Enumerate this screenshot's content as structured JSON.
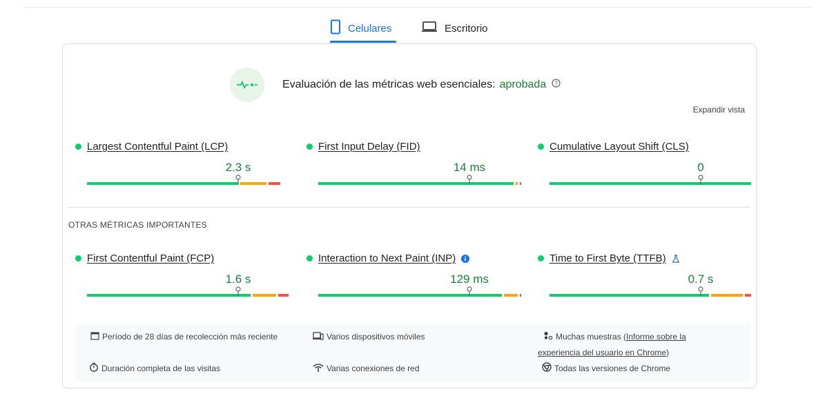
{
  "tabs": [
    {
      "label": "Celulares",
      "icon": "mobile-phone-icon",
      "active": true
    },
    {
      "label": "Escritorio",
      "icon": "laptop-icon",
      "active": false
    }
  ],
  "assessment": {
    "text": "Evaluación de las métricas web esenciales:",
    "status": "aprobada",
    "icon": "pulse-icon"
  },
  "expand_label": "Expandir vista",
  "section_title": "OTRAS MÉTRICAS IMPORTANTES",
  "colors": {
    "good": "#0cce6b",
    "needs_improvement": "#ffa400",
    "poor": "#ff4e42",
    "accent": "#1a73e8",
    "value_green": "#188038"
  },
  "core_metrics": [
    {
      "label": "Largest Contentful Paint (LCP)",
      "value": "2.3 s",
      "distribution": {
        "good": 0.75,
        "needs_improvement": 0.14,
        "poor": 0.07
      },
      "marker": 0.75
    },
    {
      "label": "First Input Delay (FID)",
      "value": "14 ms",
      "distribution": {
        "good": 0.97,
        "needs_improvement": 0.02,
        "poor": 0.01
      },
      "marker": 0.75
    },
    {
      "label": "Cumulative Layout Shift (CLS)",
      "value": "0",
      "distribution": {
        "good": 1.0,
        "needs_improvement": 0,
        "poor": 0
      },
      "marker": 0.75
    }
  ],
  "other_metrics": [
    {
      "label": "First Contentful Paint (FCP)",
      "value": "1.6 s",
      "distribution": {
        "good": 0.81,
        "needs_improvement": 0.13,
        "poor": 0.06
      },
      "marker": 0.75
    },
    {
      "label": "Interaction to Next Paint (INP)",
      "value": "129 ms",
      "distribution": {
        "good": 0.91,
        "needs_improvement": 0.08,
        "poor": 0.01
      },
      "marker": 0.75,
      "extra_icon": "info-icon"
    },
    {
      "label": "Time to First Byte (TTFB)",
      "value": "0.7 s",
      "distribution": {
        "good": 0.79,
        "needs_improvement": 0.17,
        "poor": 0.04
      },
      "marker": 0.75,
      "extra_icon": "flask-icon"
    }
  ],
  "info": {
    "period": "Período de 28 días de recolección más reciente",
    "devices": "Varios dispositivos móviles",
    "samples_prefix": "Muchas muestras (",
    "samples_link": "Informe sobre la experiencia del usuario en Chrome",
    "samples_suffix": ")",
    "duration": "Duración completa de las visitas",
    "connections": "Varias conexiones de red",
    "versions": "Todas las versiones de Chrome"
  }
}
